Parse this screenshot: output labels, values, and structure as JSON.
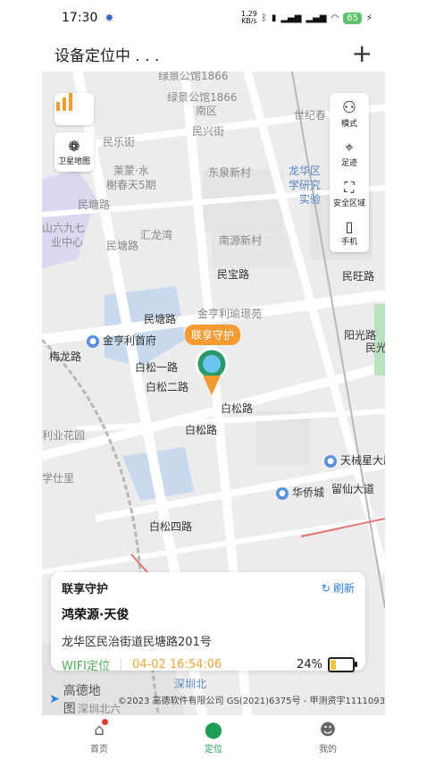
{
  "status_bar": {
    "time": "17:30",
    "net_speed": "1.29\nKB/s",
    "battery": "65"
  },
  "header": {
    "title": "设备定位中 . . .",
    "add_icon": "plus-icon"
  },
  "map": {
    "labels": {
      "l1": "绿景公馆1866",
      "l2": "绿景公馆1866",
      "l3": "南区",
      "l4": "民兴街",
      "l5": "世纪春",
      "l6": "民乐街",
      "l7": "莱蒙·水",
      "l8": "榭春天5期",
      "l9": "东泉新村",
      "l10": "龙华区",
      "l11": "学研究",
      "l12": "实验",
      "l13": "民塘路",
      "l14": "民塘路",
      "l15": "汇龙湾",
      "l16": "山六九七",
      "l17": "业中心",
      "l18": "南源新村",
      "l19": "民宝路",
      "l20": "民旺路",
      "l21": "金亨利瑜璟苑",
      "l22": "金亨利首府",
      "l23": "民塘路",
      "l24": "白松一路",
      "l25": "白松二路",
      "l26": "白松路",
      "l27": "白松路",
      "l28": "阳光路",
      "l29": "民光",
      "l30": "梅龙路",
      "l31": "利业花园",
      "l32": "学仕里",
      "l33": "天械星大厦",
      "l34": "华侨城",
      "l35": "留仙大道",
      "l36": "白松四路",
      "l37": "深圳北",
      "l38": "深圳北六"
    },
    "left_buttons": {
      "heat": "chart-icon",
      "satellite": "卫星地图"
    },
    "right_panel": {
      "mode": "模式",
      "track": "足迹",
      "safe_zone": "安全区域",
      "phone": "手机"
    },
    "marker_tag": "联享守护",
    "copyright": "©2023 高德软件有限公司 GS(2021)6375号 - 甲测资字1111093",
    "brand": "高德地图"
  },
  "card": {
    "title": "联享守护",
    "refresh": "刷新",
    "place": "鸿荣源·天俊",
    "address": "龙华区民治街道民塘路201号",
    "location_type": "WIFI定位",
    "timestamp": "04-02 16:54:06",
    "battery_text": "24%",
    "battery_level": 0.24
  },
  "bottom_nav": {
    "home": "首页",
    "locate": "定位",
    "mine": "我的",
    "active_color": "#1f9d55"
  }
}
